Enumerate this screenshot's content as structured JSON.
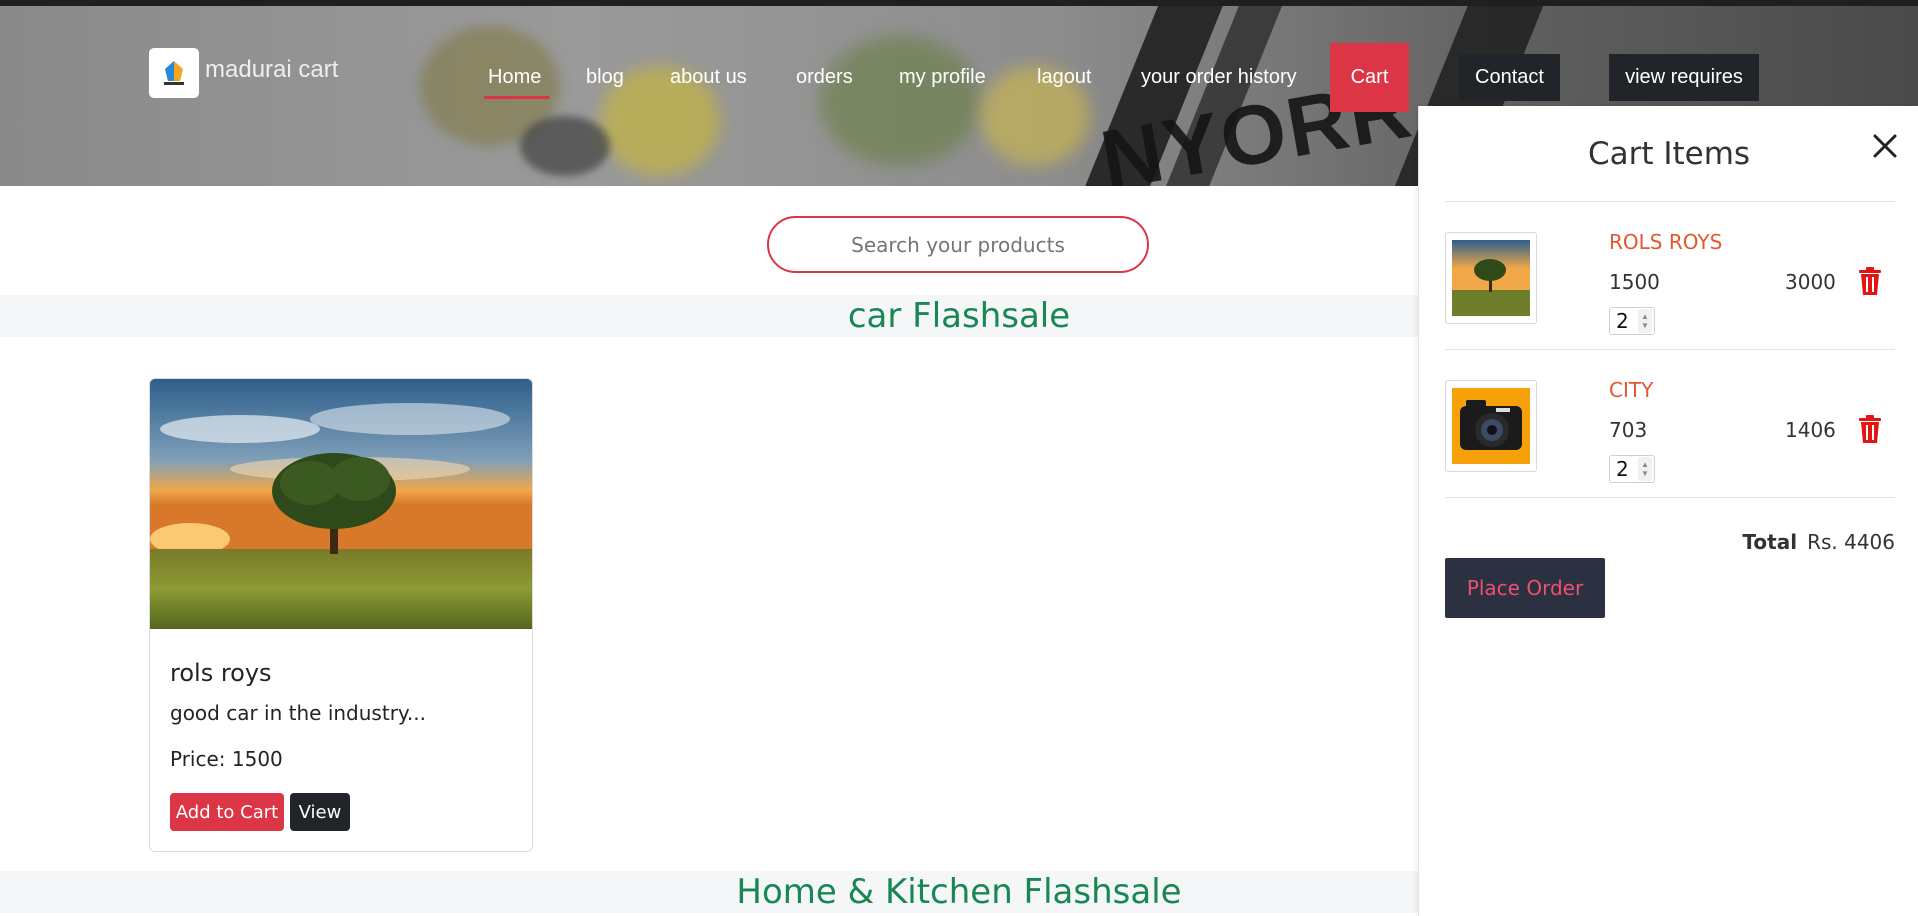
{
  "header": {
    "logo_text": "madurai cart",
    "nav": [
      {
        "label": "Home"
      },
      {
        "label": "blog"
      },
      {
        "label": "about us"
      },
      {
        "label": "orders"
      },
      {
        "label": "my profile"
      },
      {
        "label": "lagout"
      },
      {
        "label": "your order history"
      }
    ],
    "cart_label": "Cart",
    "contact_label": "Contact",
    "view_requires_label": "view requires"
  },
  "search": {
    "placeholder": "Search your products"
  },
  "sections": [
    {
      "title": "car Flashsale"
    },
    {
      "title": "Home & Kitchen Flashsale"
    }
  ],
  "product": {
    "title": "rols roys",
    "description": "good car in the industry...",
    "price": "Price: 1500",
    "add_to_cart_label": "Add to Cart",
    "view_label": "View"
  },
  "cart": {
    "title": "Cart Items",
    "items": [
      {
        "name": "ROLS ROYS",
        "price": "1500",
        "subtotal": "3000",
        "qty": "2"
      },
      {
        "name": "CITY",
        "price": "703",
        "subtotal": "1406",
        "qty": "2"
      }
    ],
    "total_label": "Total",
    "total_value": "Rs. 4406",
    "place_order_label": "Place Order"
  },
  "colors": {
    "accent_red": "#dc3545",
    "section_green": "#198754",
    "item_name_orange": "#e4572e",
    "dark": "#212529"
  }
}
